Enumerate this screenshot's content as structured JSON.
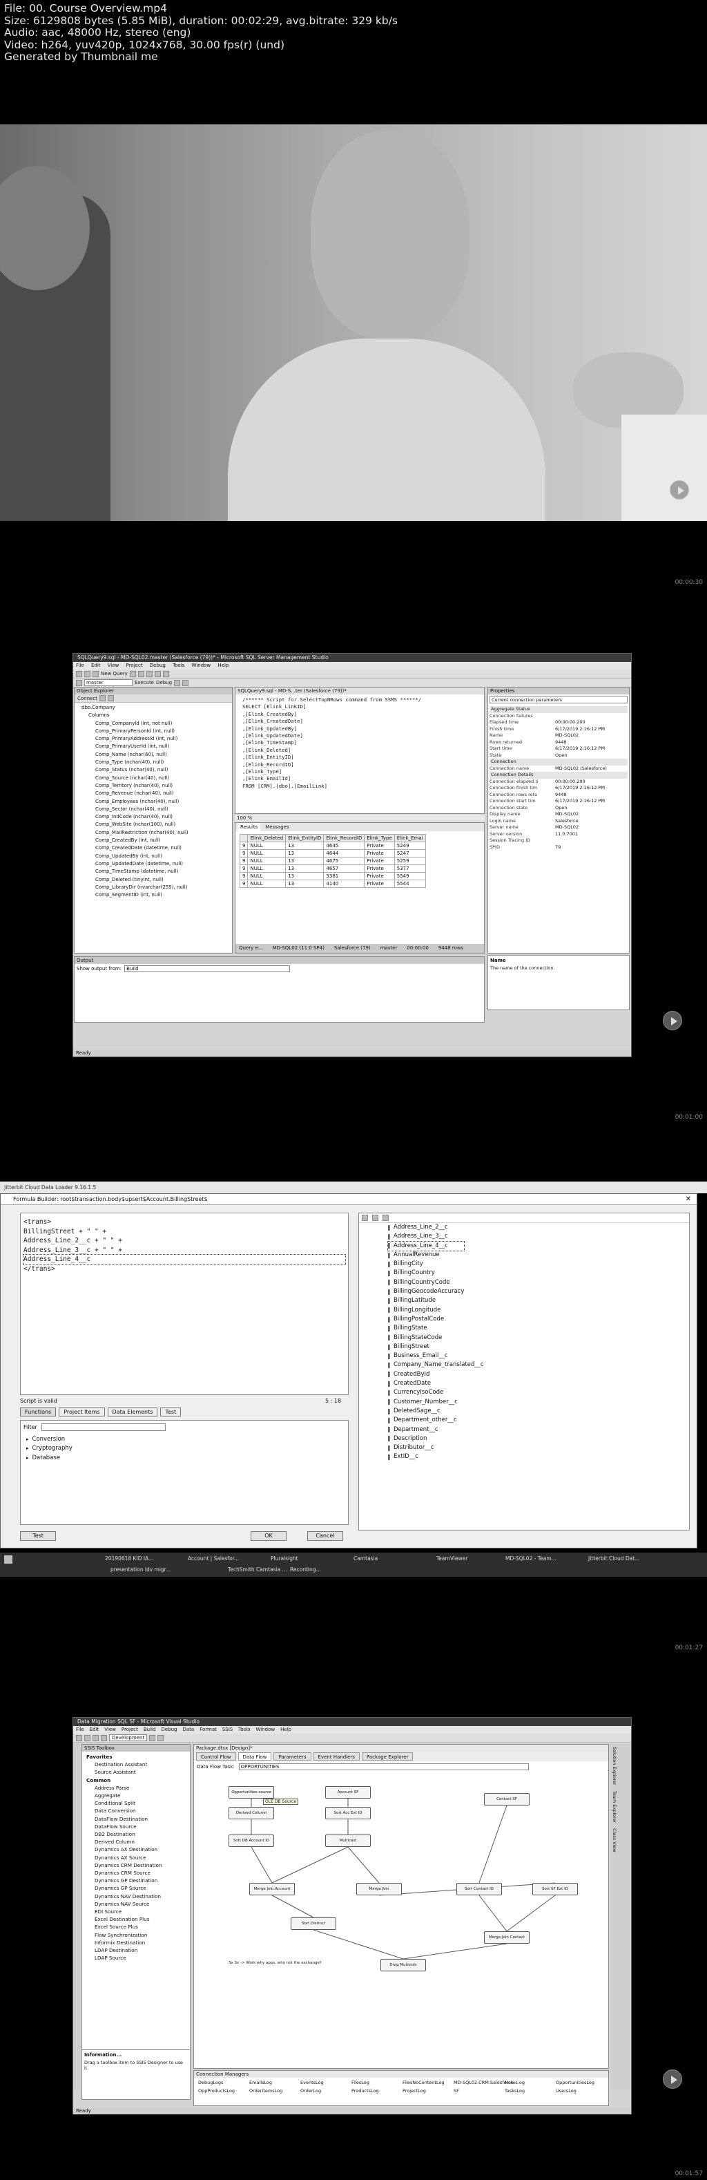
{
  "info": {
    "line1": "File: 00. Course Overview.mp4",
    "line2": "Size: 6129808 bytes (5.85 MiB), duration: 00:02:29, avg.bitrate: 329 kb/s",
    "line3": "Audio: aac, 48000 Hz, stereo (eng)",
    "line4": "Video: h264, yuv420p, 1024x768, 30.00 fps(r) (und)",
    "line5": "Generated by Thumbnail me"
  },
  "timestamps": [
    "00:00:30",
    "00:01:00",
    "00:01:27",
    "00:01:57"
  ],
  "colors": {
    "background": "#000000",
    "play_button": "#5a5a5a"
  },
  "ssms": {
    "title": "SQLQuery9.sql - MD-SQL02.master (Salesforce (79))* - Microsoft SQL Server Management Studio",
    "menu": [
      "File",
      "Edit",
      "View",
      "Project",
      "Debug",
      "Tools",
      "Window",
      "Help"
    ],
    "toolbar": {
      "new_query": "New Query",
      "db": "master",
      "execute": "Execute",
      "debug": "Debug"
    },
    "object_explorer": {
      "title": "Object Explorer",
      "connect": "Connect",
      "items": [
        "dbo.Company",
        "Columns",
        "Comp_CompanyId (int, not null)",
        "Comp_PrimaryPersonId (int, null)",
        "Comp_PrimaryAddressId (int, null)",
        "Comp_PrimaryUserId (int, null)",
        "Comp_Name (nchar(60), null)",
        "Comp_Type (nchar(40), null)",
        "Comp_Status (nchar(40), null)",
        "Comp_Source (nchar(40), null)",
        "Comp_Territory (nchar(40), null)",
        "Comp_Revenue (nchar(40), null)",
        "Comp_Employees (nchar(40), null)",
        "Comp_Sector (nchar(40), null)",
        "Comp_IndCode (nchar(40), null)",
        "Comp_WebSite (nchar(100), null)",
        "Comp_MailRestriction (nchar(40), null)",
        "Comp_CreatedBy (int, null)",
        "Comp_CreatedDate (datetime, null)",
        "Comp_UpdatedBy (int, null)",
        "Comp_UpdatedDate (datetime, null)",
        "Comp_TimeStamp (datetime, null)",
        "Comp_Deleted (tinyint, null)",
        "Comp_LibraryDir (nvarchar(255), null)",
        "Comp_SegmentID (int, null)"
      ]
    },
    "query_tab": "SQLQuery9.sql - MD-S...ter (Salesforce (79))*",
    "code": [
      "/****** Script for SelectTopNRows command from SSMS ******/",
      "SELECT [Elink_LinkID]",
      "      ,[Elink_CreatedBy]",
      "      ,[Elink_CreatedDate]",
      "      ,[Elink_UpdatedBy]",
      "      ,[Elink_UpdatedDate]",
      "      ,[Elink_TimeStamp]",
      "      ,[Elink_Deleted]",
      "      ,[Elink_EntityID]",
      "      ,[Elink_RecordID]",
      "      ,[Elink_Type]",
      "      ,[Elink_EmailId]",
      "  FROM [CRM].[dbo].[EmailLink]"
    ],
    "zoom": "100 %",
    "result_tabs": [
      "Results",
      "Messages"
    ],
    "results": {
      "columns": [
        "",
        "Elink_Deleted",
        "Elink_EntityID",
        "Elink_RecordID",
        "Elink_Type",
        "Elink_Emai"
      ],
      "rows": [
        [
          "9",
          "NULL",
          "13",
          "4645",
          "Private",
          "5249"
        ],
        [
          "9",
          "NULL",
          "13",
          "4644",
          "Private",
          "5247"
        ],
        [
          "9",
          "NULL",
          "13",
          "4675",
          "Private",
          "5259"
        ],
        [
          "9",
          "NULL",
          "13",
          "4657",
          "Private",
          "5377"
        ],
        [
          "9",
          "NULL",
          "13",
          "3381",
          "Private",
          "5549"
        ],
        [
          "9",
          "NULL",
          "13",
          "4140",
          "Private",
          "5544"
        ]
      ]
    },
    "query_status": {
      "message": "Query e...",
      "server": "MD-SQL02 (11.0 SP4)",
      "user": "Salesforce (79)",
      "db": "master",
      "time": "00:00:00",
      "rows": "9448 rows"
    },
    "properties": {
      "title": "Properties",
      "selector": "Current connection parameters",
      "categories": [
        {
          "name": "Aggregate Status",
          "rows": [
            [
              "Connection failures",
              ""
            ],
            [
              "Elapsed time",
              "00:00:00.200"
            ],
            [
              "Finish time",
              "6/17/2019 2:16:12 PM"
            ],
            [
              "Name",
              "MD-SQL02"
            ],
            [
              "Rows returned",
              "9448"
            ],
            [
              "Start time",
              "6/17/2019 2:16:12 PM"
            ],
            [
              "State",
              "Open"
            ]
          ]
        },
        {
          "name": "Connection",
          "rows": [
            [
              "Connection name",
              "MD-SQL02 (Salesforce)"
            ]
          ]
        },
        {
          "name": "Connection Details",
          "rows": [
            [
              "Connection elapsed ti",
              "00:00:00.200"
            ],
            [
              "Connection finish tim",
              "6/17/2019 2:16:12 PM"
            ],
            [
              "Connection rows retu",
              "9448"
            ],
            [
              "Connection start tim",
              "6/17/2019 2:16:12 PM"
            ],
            [
              "Connection state",
              "Open"
            ],
            [
              "Display name",
              "MD-SQL02"
            ],
            [
              "Login name",
              "Salesforce"
            ],
            [
              "Server name",
              "MD-SQL02"
            ],
            [
              "Server version",
              "11.0.7001"
            ],
            [
              "Session Tracing ID",
              ""
            ],
            [
              "SPID",
              "79"
            ]
          ]
        }
      ],
      "desc_title": "Name",
      "desc_text": "The name of the connection."
    },
    "output": {
      "title": "Output",
      "label": "Show output from:",
      "value": "Build"
    },
    "status": "Ready"
  },
  "formula": {
    "window_title": "Jitterbit Cloud Data Loader 9.16.1.5",
    "title": "Formula Builder: root$transaction.body$upsert$Account.BillingStreet$",
    "code": [
      "<trans>",
      "BillingStreet + \" \" +",
      "Address_Line_2__c + \" \" +",
      "Address_Line_3__c + \" \" +",
      "Address_Line_4__c",
      "</trans>"
    ],
    "valid": "Script is valid",
    "position": "5 : 18",
    "tabs": [
      "Functions",
      "Project Items",
      "Data Elements",
      "Test"
    ],
    "filter_label": "Filter",
    "categories": [
      "Conversion",
      "Cryptography",
      "Database"
    ],
    "test": "Test",
    "ok": "OK",
    "cancel": "Cancel",
    "fields": [
      "Address_Line_2__c",
      "Address_Line_3__c",
      "Address_Line_4__c",
      "AnnualRevenue",
      "BillingCity",
      "BillingCountry",
      "BillingCountryCode",
      "BillingGeocodeAccuracy",
      "BillingLatitude",
      "BillingLongitude",
      "BillingPostalCode",
      "BillingState",
      "BillingStateCode",
      "BillingStreet",
      "Business_Email__c",
      "Company_Name_translated__c",
      "CreatedById",
      "CreatedDate",
      "CurrencyIsoCode",
      "Customer_Number__c",
      "DeletedSage__c",
      "Department_other__c",
      "Department__c",
      "Description",
      "Distributor__c",
      "ExtID__c"
    ],
    "taskbar": {
      "items": [
        "20190618 KID IA...",
        "Account | Salesfor...",
        "Pluralsight",
        "Camtasia",
        "TeamViewer",
        "MD-SQL02 - Team...",
        "Jitterbit Cloud Dat..."
      ],
      "items2": [
        "presentation ldv migr...",
        "TechSmith Camtasia ...",
        "Recording..."
      ]
    }
  },
  "ssis": {
    "title": "Data Migration SQL SF - Microsoft Visual Studio",
    "menu": [
      "File",
      "Edit",
      "View",
      "Project",
      "Build",
      "Debug",
      "Data",
      "Format",
      "SSIS",
      "Tools",
      "Window",
      "Help"
    ],
    "config": "Development",
    "toolbox_title": "SSIS Toolbox",
    "favorites": "Favorites",
    "favorites_items": [
      "Destination Assistant",
      "Source Assistant"
    ],
    "common": "Common",
    "common_items": [
      "Address Parse",
      "Aggregate",
      "Conditional Split",
      "Data Conversion",
      "DataFlow Destination",
      "DataFlow Source",
      "DB2 Destination",
      "Derived Column",
      "Dynamics AX Destination",
      "Dynamics AX Source",
      "Dynamics CRM Destination",
      "Dynamics CRM Source",
      "Dynamics GP Destination",
      "Dynamics GP Source",
      "Dynamics NAV Destination",
      "Dynamics NAV Source",
      "EDI Source",
      "Excel Destination Plus",
      "Excel Source Plus",
      "Flow Synchronization",
      "Informix Destination",
      "LDAP Destination",
      "LDAP Source"
    ],
    "info_title": "Information...",
    "info_text": "Drag a toolbox item to SSIS Designer to use it.",
    "doc_tab": "Package.dtsx [Design]*",
    "designer_tabs": [
      "Control Flow",
      "Data Flow",
      "Parameters",
      "Event Handlers",
      "Package Explorer"
    ],
    "task_label": "Data Flow Task:",
    "task_value": "OPPORTUNITIES",
    "nodes": [
      "Opportunities source",
      "Account SF",
      "Contact SF",
      "Derived Column",
      "Sort Acc Ext ID",
      "Sort DB Account ID",
      "Multicast",
      "Merge Join Account",
      "Merge Join",
      "Sort Contact ID",
      "Sort SF Ext ID",
      "Sort Distinct",
      "Merge Join Contact",
      "Drop Multicols"
    ],
    "tooltip": "OLE DB Source",
    "annotation": "3x 3x -> Work why apps, why not the exchange?",
    "cm_title": "Connection Managers",
    "cm_items": [
      "DebugLogs",
      "EmailsLog",
      "EventsLog",
      "FilesLog",
      "FilesNoContentLog",
      "MD-SQL02.CRM.Salesforce",
      "Notes.og",
      "OpportunitiesLog",
      "OppProductsLog",
      "OrderItemsLog",
      "OrderLog",
      "ProductsLog",
      "ProjectLog",
      "SF",
      "TasksLog",
      "UsersLog"
    ],
    "right_tabs": [
      "Solution Explorer",
      "Team Explorer",
      "Class View"
    ],
    "status": "Ready"
  }
}
